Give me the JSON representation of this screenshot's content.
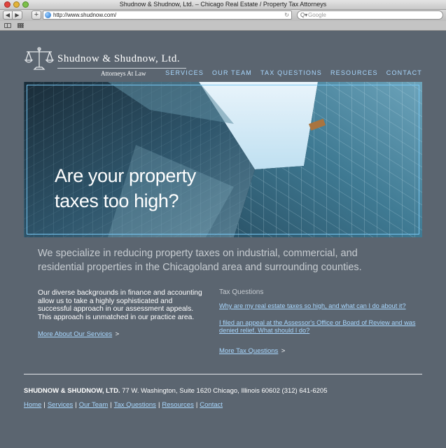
{
  "browser": {
    "title": "Shudnow & Shudnow, Ltd. – Chicago Real Estate / Property Tax Attorneys",
    "url": "http://www.shudnow.com/",
    "search_placeholder": "Google",
    "back_glyph": "◀",
    "forward_glyph": "▶",
    "add_glyph": "+",
    "reload_glyph": "↻",
    "search_glyph": "Q▾"
  },
  "header": {
    "brand": "Shudnow & Shudnow, Ltd.",
    "tagline": "Attorneys At Law",
    "nav": [
      "SERVICES",
      "OUR TEAM",
      "TAX QUESTIONS",
      "RESOURCES",
      "CONTACT"
    ]
  },
  "hero": {
    "line1": "Are your property",
    "line2": "taxes too high?"
  },
  "intro": "We specialize in reducing property taxes on industrial, commercial, and residential properties in the Chicagoland area and surrounding counties.",
  "left_column": {
    "body": "Our diverse backgrounds in finance and accounting allow us to take a highly sophisticated and successful approach in our assessment appeals. This approach is unmatched in our practice area.",
    "link": "More About Our Services",
    "arrow": ">"
  },
  "right_column": {
    "heading": "Tax Questions",
    "questions": [
      "Why are my real estate taxes so high, and what can I do about it?",
      "I filed an appeal at the Assessor's Office or Board of Review and was denied relief. What should I do?"
    ],
    "more_link": "More Tax Questions",
    "arrow": ">"
  },
  "footer": {
    "company": "SHUDNOW & SHUDNOW, LTD.",
    "address": "77 W. Washington, Suite 1620 Chicago, Illinois 60602 (312) 641-6205",
    "links": [
      "Home",
      "Services",
      "Our Team",
      "Tax Questions",
      "Resources",
      "Contact"
    ],
    "separator": "|"
  },
  "colors": {
    "page_background": "#5b6570",
    "link": "#a9d8ff",
    "hero_frame": "#78c6f2",
    "muted_text": "#c7ccd1"
  }
}
